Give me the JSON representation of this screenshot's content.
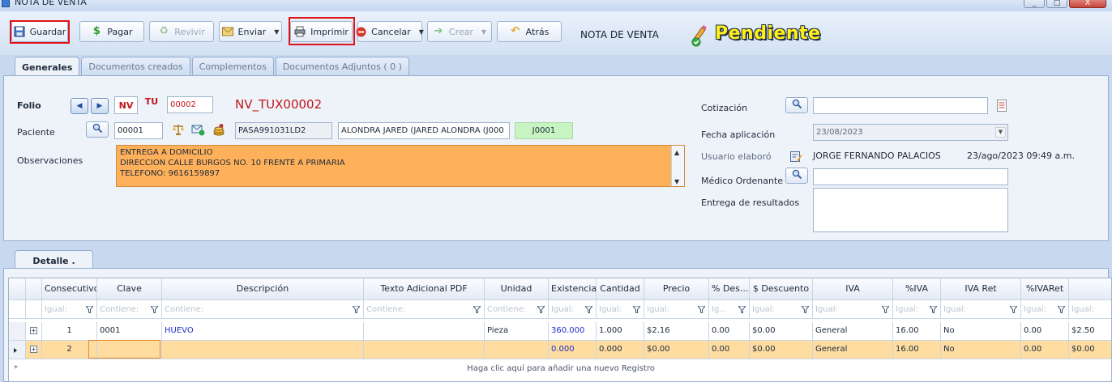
{
  "window": {
    "title": "NOTA DE VENTA",
    "controls": [
      "_",
      "□",
      "X"
    ]
  },
  "toolbar": {
    "guardar": "Guardar",
    "pagar": "Pagar",
    "revivir": "Revivir",
    "enviar": "Enviar",
    "imprimir": "Imprimir",
    "cancelar": "Cancelar",
    "crear": "Crear",
    "atras": "Atrás",
    "doc_title": "NOTA DE VENTA",
    "status": "Pendiente",
    "highlight_color": "#e0131a"
  },
  "tabs_top": [
    "Generales",
    "Documentos creados",
    "Complementos",
    "Documentos Adjuntos ( 0 )"
  ],
  "general": {
    "folio_label": "Folio",
    "prefix1": "NV",
    "prefix2": "TU",
    "folio_number": "00002",
    "folio_code": "NV_TUX00002",
    "paciente_label": "Paciente",
    "paciente_id": "00001",
    "rfc": "PASA991031LD2",
    "paciente_name": "ALONDRA JARED (JARED ALONDRA (J000",
    "paciente_code": "J0001",
    "observaciones_label": "Observaciones",
    "observaciones_lines": [
      "ENTREGA A DOMICILIO",
      "DIRECCION CALLE BURGOS NO. 10 FRENTE A PRIMARIA",
      "TELEFONO: 9616159897"
    ],
    "cotizacion_label": "Cotización",
    "cotizacion_value": "",
    "fecha_label": "Fecha aplicación",
    "fecha_value": "23/08/2023",
    "usuario_label": "Usuario elaboró",
    "usuario_value": "JORGE FERNANDO PALACIOS",
    "usuario_fecha": "23/ago/2023 09:49 a.m.",
    "medico_label": "Médico Ordenante",
    "medico_value": "",
    "entrega_label": "Entrega de resultados",
    "entrega_value": "",
    "observaciones_color": "#ffb05a",
    "code_color": "#c7f4c1"
  },
  "tabs_bottom": [
    "Detalle ."
  ],
  "grid": {
    "columns": [
      "Consecutivo",
      "Clave",
      "Descripción",
      "Texto Adicional PDF",
      "Unidad",
      "Existencia",
      "Cantidad",
      "Precio",
      "% Des...",
      "$ Descuento",
      "IVA",
      "%IVA",
      "IVA Ret",
      "%IVARet",
      ""
    ],
    "filters": [
      "Igual:",
      "Contiene:",
      "Contiene:",
      "Contiene:",
      "Contiene:",
      "Igual:",
      "Igual:",
      "Igual:",
      "Ig...",
      "Igual:",
      "Igual:",
      "Igual:",
      "Igual:",
      "Igual:",
      "Igual:"
    ],
    "rows": [
      [
        "1",
        "0001",
        "HUEVO",
        "",
        "Pieza",
        "360.000",
        "1.000",
        "$2.16",
        "0.00",
        "$0.00",
        "General",
        "16.00",
        "No",
        "0.00",
        "$2.50"
      ],
      [
        "2",
        "",
        "",
        "",
        "",
        "0.000",
        "0.000",
        "$0.00",
        "0.00",
        "$0.00",
        "General",
        "16.00",
        "No",
        "0.00",
        "$0.00"
      ]
    ],
    "add_row_text": "Haga clic aquí para añadir una nuevo Registro",
    "add_row_marker": "*",
    "selected_row_color": "#ffdca0"
  }
}
